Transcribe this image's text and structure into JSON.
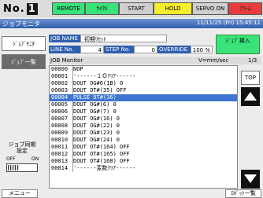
{
  "robot": {
    "label": "No.",
    "digit": "1"
  },
  "indicators": {
    "remote": "REMOTE",
    "mode": "ｻｲｸﾙ",
    "start": "START",
    "hold": "HOLD",
    "servo": "SERVO ON",
    "alarm": "ｱﾗｰﾑ"
  },
  "titlebar": {
    "title": "ジョブモニタ",
    "datetime": "11/11/25 (Fri) 15:45:11"
  },
  "sidebar": {
    "monitor_button": "ｼﾞｮﾌﾞﾓﾆﾀ",
    "list_button": "ｼﾞｮﾌﾞ一覧",
    "sync_label": "ジョブ同期設定",
    "sync_off": "OFF",
    "sync_on": "ON"
  },
  "job_header": {
    "job_name_label": "JOB NAME",
    "job_name_value": "初期ﾘｾｯﾄ",
    "line_label": "LINE No.",
    "line_value": "4",
    "step_label": "STEP No.",
    "step_value": "0",
    "override_label": "OVERRIDE",
    "override_value": "100 %",
    "insert_button": "ｼﾞｮﾌﾞ挿入"
  },
  "monitor": {
    "title": "JOB Monitor",
    "speed_unit": "V=mm/sec",
    "page": "1/3",
    "selected_index": 4,
    "rows": [
      {
        "num": "00000",
        "text": "NOP"
      },
      {
        "num": "00001",
        "text": "'------１Ｏｸﾘｱ------"
      },
      {
        "num": "00002",
        "text": "DOUT OG#6(1B) 0"
      },
      {
        "num": "00003",
        "text": "DOUT OT#(35) OFF"
      },
      {
        "num": "00004",
        "text": "PULSE OT#(36)"
      },
      {
        "num": "00005",
        "text": "DOUT OG#(6) 0"
      },
      {
        "num": "00006",
        "text": "DOUT OG#(7) 0"
      },
      {
        "num": "00007",
        "text": "DOUT OG#(16) 0"
      },
      {
        "num": "00008",
        "text": "DOUT OG#(22) 0"
      },
      {
        "num": "00009",
        "text": "DOUT OG#(23) 0"
      },
      {
        "num": "00010",
        "text": "DOUT OG#(24) 0"
      },
      {
        "num": "00011",
        "text": "DOUT OT#(164) OFF"
      },
      {
        "num": "00012",
        "text": "DOUT OT#(165) OFF"
      },
      {
        "num": "00013",
        "text": "DOUT OT#(168) OFF"
      },
      {
        "num": "00014",
        "text": "'------変数ｸﾘｱ------"
      }
    ]
  },
  "scroll": {
    "top_button": "TOP"
  },
  "footer": {
    "menu_button": "メニュー",
    "robot_list_button": "ﾛﾎﾞｯﾄ一覧"
  },
  "colors": {
    "indicator_green": "#39e37a",
    "indicator_yellow": "#f5ee2a",
    "indicator_red": "#e63c3c",
    "title_blue": "#2f5fae",
    "selection_blue": "#3d75d1"
  }
}
